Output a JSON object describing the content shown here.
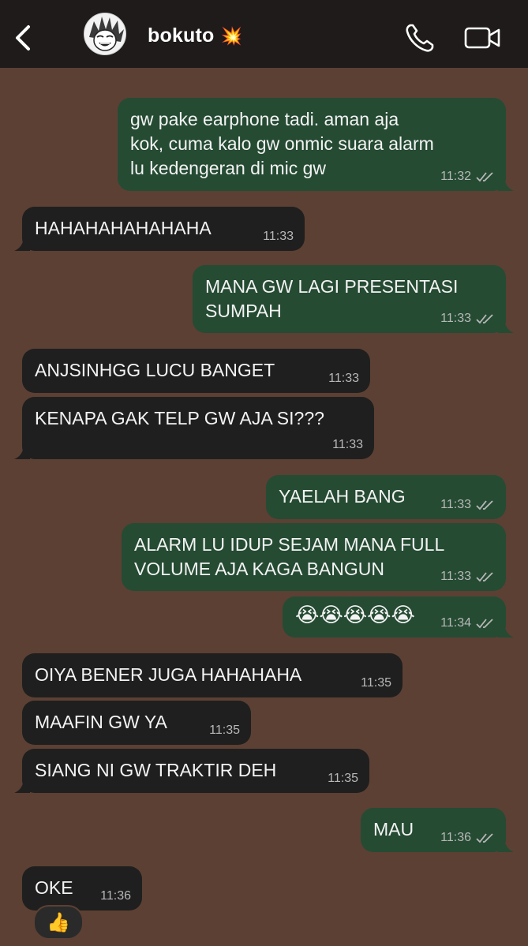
{
  "header": {
    "contact_name": "bokuto",
    "name_emoji": "💥",
    "icons": [
      "back-chevron-icon",
      "call-icon",
      "video-call-icon"
    ]
  },
  "messages": [
    {
      "dir": "out",
      "text": "gw pake earphone tadi. aman aja\nkok, cuma kalo gw onmic suara alarm\nlu kedengeran di mic gw",
      "time": "11:32"
    },
    {
      "dir": "in",
      "text": "HAHAHAHAHAHAHA",
      "time": "11:33"
    },
    {
      "dir": "out",
      "text": "MANA GW LAGI PRESENTASI\nSUMPAH",
      "time": "11:33"
    },
    {
      "dir": "in",
      "text": "ANJSINHGG LUCU BANGET",
      "time": "11:33"
    },
    {
      "dir": "in",
      "text": "KENAPA GAK TELP GW AJA SI???",
      "time": "11:33"
    },
    {
      "dir": "out",
      "text": "YAELAH BANG",
      "time": "11:33"
    },
    {
      "dir": "out",
      "text": "ALARM LU IDUP SEJAM MANA FULL\nVOLUME AJA KAGA BANGUN",
      "time": "11:33"
    },
    {
      "dir": "out",
      "text": "😭😭😭😭😭",
      "time": "11:34"
    },
    {
      "dir": "in",
      "text": "OIYA BENER JUGA HAHAHAHA",
      "time": "11:35"
    },
    {
      "dir": "in",
      "text": "MAAFIN GW YA",
      "time": "11:35"
    },
    {
      "dir": "in",
      "text": "SIANG NI GW TRAKTIR DEH",
      "time": "11:35"
    },
    {
      "dir": "out",
      "text": "MAU",
      "time": "11:36"
    },
    {
      "dir": "in",
      "text": "OKE",
      "time": "11:36"
    }
  ],
  "reaction": "👍",
  "colors": {
    "chat_bg": "#5c4033",
    "header_bg": "#1f1b1a",
    "outgoing_bubble": "#254b33",
    "incoming_bubble": "#1f1f1f"
  }
}
